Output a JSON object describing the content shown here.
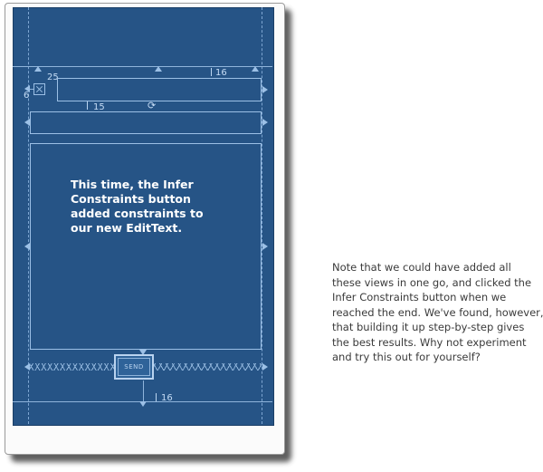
{
  "blueprint": {
    "dimensions": {
      "d25": "25",
      "d16_top": "16",
      "d6": "6",
      "d15": "15",
      "d16_bottom": "16"
    },
    "send_button_label": "SEND"
  },
  "annotations": {
    "inline_note_lines": [
      "This time, the Infer",
      "Constraints button",
      "added constraints to",
      "our new EditText."
    ],
    "side_note_lines": [
      "Note that we could have added all",
      "these views in one go, and clicked the",
      "Infer Constraints button when we",
      "reached the end. We've found, however,",
      "that building it up step-by-step gives",
      "the best results. Why not experiment",
      "and try this out for yourself?"
    ]
  },
  "colors": {
    "blueprint_bg": "#265486",
    "line": "#9cc0e6",
    "note_text": "#3a3a3a"
  }
}
